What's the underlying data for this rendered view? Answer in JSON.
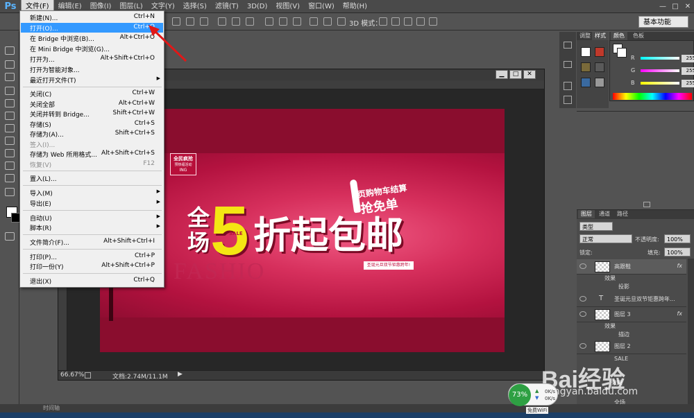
{
  "menubar": {
    "logo": "Ps",
    "items": [
      "文件(F)",
      "编辑(E)",
      "图像(I)",
      "图层(L)",
      "文字(Y)",
      "选择(S)",
      "滤镜(T)",
      "3D(D)",
      "视图(V)",
      "窗口(W)",
      "帮助(H)"
    ],
    "window_buttons": [
      "—",
      "□",
      "✕"
    ]
  },
  "options_bar": {
    "mode_label": "3D 模式：",
    "workspace": "基本功能"
  },
  "file_menu": {
    "items": [
      {
        "label": "新建(N)...",
        "shortcut": "Ctrl+N"
      },
      {
        "label": "打开(O)...",
        "shortcut": "Ctrl+O",
        "highlighted": true
      },
      {
        "label": "在 Bridge 中浏览(B)...",
        "shortcut": "Alt+Ctrl+O"
      },
      {
        "label": "在 Mini Bridge 中浏览(G)...",
        "shortcut": ""
      },
      {
        "label": "打开为...",
        "shortcut": "Alt+Shift+Ctrl+O"
      },
      {
        "label": "打开为智能对象...",
        "shortcut": ""
      },
      {
        "label": "最近打开文件(T)",
        "shortcut": "",
        "submenu": true
      },
      {
        "label": "关闭(C)",
        "shortcut": "Ctrl+W"
      },
      {
        "label": "关闭全部",
        "shortcut": "Alt+Ctrl+W"
      },
      {
        "label": "关闭并转到 Bridge...",
        "shortcut": "Shift+Ctrl+W"
      },
      {
        "label": "存储(S)",
        "shortcut": "Ctrl+S"
      },
      {
        "label": "存储为(A)...",
        "shortcut": "Shift+Ctrl+S"
      },
      {
        "label": "签入(I)...",
        "shortcut": "",
        "disabled": true
      },
      {
        "label": "存储为 Web 所用格式...",
        "shortcut": "Alt+Shift+Ctrl+S"
      },
      {
        "label": "恢复(V)",
        "shortcut": "F12",
        "disabled": true
      },
      {
        "label": "置入(L)...",
        "shortcut": ""
      },
      {
        "label": "导入(M)",
        "shortcut": "",
        "submenu": true
      },
      {
        "label": "导出(E)",
        "shortcut": "",
        "submenu": true
      },
      {
        "label": "自动(U)",
        "shortcut": "",
        "submenu": true
      },
      {
        "label": "脚本(R)",
        "shortcut": "",
        "submenu": true
      },
      {
        "label": "文件简介(F)...",
        "shortcut": "Alt+Shift+Ctrl+I"
      },
      {
        "label": "打印(P)...",
        "shortcut": "Ctrl+P"
      },
      {
        "label": "打印一份(Y)",
        "shortcut": "Alt+Shift+Ctrl+P"
      },
      {
        "label": "退出(X)",
        "shortcut": "Ctrl+Q"
      }
    ]
  },
  "document": {
    "zoom": "66.67%",
    "doc_size": "文档:2.74M/11.1M"
  },
  "banner": {
    "badge_line1": "全民疯抢",
    "badge_line2": "预热福活动",
    "badge_line3": "ING",
    "quan_chang": "全场",
    "five": "5",
    "sale": "SALE",
    "headline_rest": "折起包邮",
    "cart_line1": "页购物车结算",
    "cart_line2": "抢免单",
    "xmas": "圣诞元旦双节钜惠跨年!",
    "fashion": "FASHIO"
  },
  "color_panel": {
    "tabs": [
      "颜色",
      "色板"
    ],
    "channels": [
      {
        "label": "R",
        "value": "255",
        "color": "#ff3b3b"
      },
      {
        "label": "G",
        "value": "255",
        "color": "#ff3bff"
      },
      {
        "label": "B",
        "value": "255",
        "color": "#ffff3b"
      }
    ]
  },
  "side_tabs": [
    "调整",
    "样式"
  ],
  "layers_panel": {
    "tabs": [
      "图层",
      "通道",
      "路径"
    ],
    "filter": "类型",
    "blend_mode": "正常",
    "opacity_label": "不透明度:",
    "opacity": "100%",
    "lock_label": "锁定:",
    "fill_label": "填充:",
    "fill": "100%",
    "layers": [
      {
        "name": "高跟鞋",
        "fx": "fx",
        "selected": true,
        "type": "image"
      },
      {
        "name": "效果",
        "sub": 1
      },
      {
        "name": "投影",
        "sub": 2
      },
      {
        "name": "圣诞元旦双节钜惠跨年...",
        "type": "text"
      },
      {
        "name": "图层 3",
        "fx": "fx",
        "type": "image"
      },
      {
        "name": "效果",
        "sub": 1
      },
      {
        "name": "描边",
        "sub": 2
      },
      {
        "name": "图层 2",
        "type": "image"
      },
      {
        "name": "SALE",
        "sub": 0
      },
      {
        "name": "效果",
        "sub": 1
      },
      {
        "name": "全场",
        "sub": 0
      }
    ]
  },
  "timeline_label": "时间轴",
  "net_widget": {
    "percent": "73%",
    "up": "0K/s",
    "down": "0K/s",
    "free_wifi": "免费WiFi"
  },
  "watermark": {
    "brand": "Bai经验",
    "url": "jingyan.baidu.com"
  }
}
